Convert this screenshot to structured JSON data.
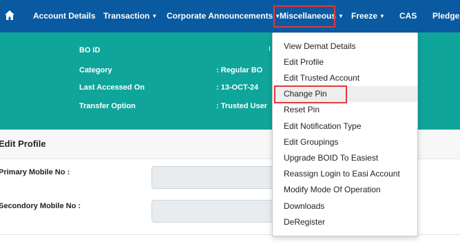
{
  "nav": {
    "items": [
      {
        "label": "Account Details",
        "caret": false
      },
      {
        "label": "Transaction",
        "caret": true
      },
      {
        "label": "Corporate Announcements",
        "caret": true
      },
      {
        "label": "Miscellaneous",
        "caret": true
      },
      {
        "label": "Freeze",
        "caret": true
      },
      {
        "label": "CAS",
        "caret": false
      },
      {
        "label": "Pledge",
        "caret": false
      }
    ]
  },
  "banner": {
    "bo_id_label": "BO ID",
    "category_label": "Category",
    "category_value": ": Regular BO",
    "last_accessed_label": "Last Accessed On",
    "last_accessed_value": ": 13-OCT-24",
    "transfer_option_label": "Transfer Option",
    "transfer_option_value": ": Trusted User",
    "partial_text": "I"
  },
  "section": {
    "title": "Edit Profile",
    "primary_mobile_label": "Primary Mobile No :",
    "secondary_mobile_label": "Secondory Mobile No :"
  },
  "dropdown": {
    "items": [
      "View Demat Details",
      "Edit Profile",
      "Edit Trusted Account",
      "Change Pin",
      "Reset Pin",
      "Edit Notification Type",
      "Edit Groupings",
      "Upgrade BOID To Easiest",
      "Reassign Login to Easi Account",
      "Modify Mode Of Operation",
      "Downloads",
      "DeRegister"
    ],
    "active_item": "Change Pin"
  },
  "colors": {
    "nav_bg": "#0a5aa1",
    "banner_bg": "#0fa59a",
    "highlight": "#e03a3a"
  }
}
